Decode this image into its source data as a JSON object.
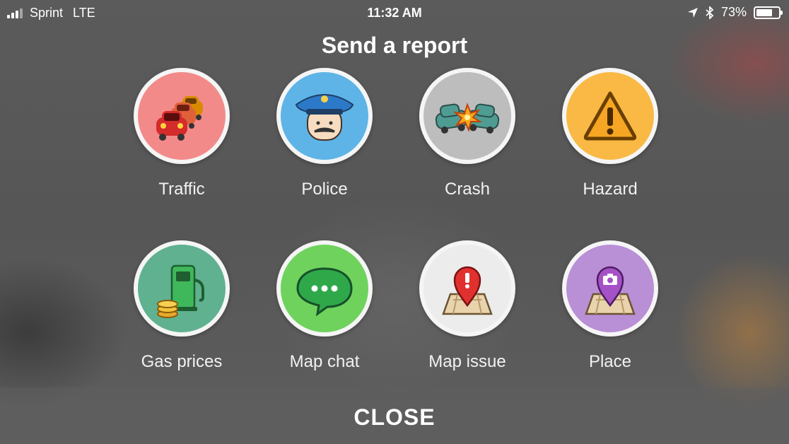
{
  "status_bar": {
    "carrier": "Sprint",
    "network": "LTE",
    "time": "11:32 AM",
    "battery_percent": "73%",
    "battery_level": 0.73
  },
  "title": "Send a report",
  "reports": [
    {
      "label": "Traffic",
      "icon": "traffic-cars-icon",
      "color": "#f28a8a"
    },
    {
      "label": "Police",
      "icon": "police-officer-icon",
      "color": "#5eb4e6"
    },
    {
      "label": "Crash",
      "icon": "car-crash-icon",
      "color": "#bdbdbd"
    },
    {
      "label": "Hazard",
      "icon": "warning-triangle-icon",
      "color": "#f9b944"
    },
    {
      "label": "Gas prices",
      "icon": "gas-pump-icon",
      "color": "#5fb18f"
    },
    {
      "label": "Map chat",
      "icon": "chat-bubble-icon",
      "color": "#6fd25d"
    },
    {
      "label": "Map issue",
      "icon": "map-issue-pin-icon",
      "color": "#ececec"
    },
    {
      "label": "Place",
      "icon": "camera-pin-icon",
      "color": "#b98fd6"
    }
  ],
  "close_label": "CLOSE"
}
